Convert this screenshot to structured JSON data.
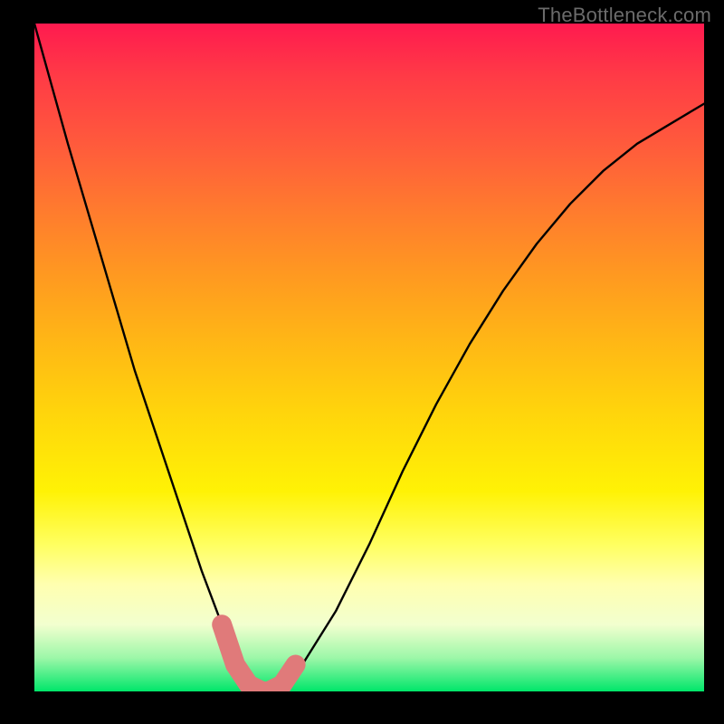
{
  "watermark": "TheBottleneck.com",
  "chart_data": {
    "type": "line",
    "title": "",
    "xlabel": "",
    "ylabel": "",
    "xlim": [
      0,
      100
    ],
    "ylim": [
      0,
      100
    ],
    "grid": false,
    "legend": false,
    "series": [
      {
        "name": "bottleneck-curve",
        "x": [
          0,
          5,
          10,
          15,
          20,
          25,
          28,
          30,
          32,
          34,
          36,
          38,
          40,
          45,
          50,
          55,
          60,
          65,
          70,
          75,
          80,
          85,
          90,
          95,
          100
        ],
        "y": [
          100,
          82,
          65,
          48,
          33,
          18,
          10,
          4,
          1,
          0,
          0,
          1,
          4,
          12,
          22,
          33,
          43,
          52,
          60,
          67,
          73,
          78,
          82,
          85,
          88
        ]
      },
      {
        "name": "valley-highlight",
        "x": [
          28,
          30,
          32,
          34,
          35,
          37,
          39
        ],
        "y": [
          10,
          4,
          1,
          0,
          0,
          1,
          4
        ]
      }
    ],
    "background_gradient": {
      "top": "#ff1a4f",
      "mid": "#ffe000",
      "bottom": "#00e66a"
    }
  }
}
